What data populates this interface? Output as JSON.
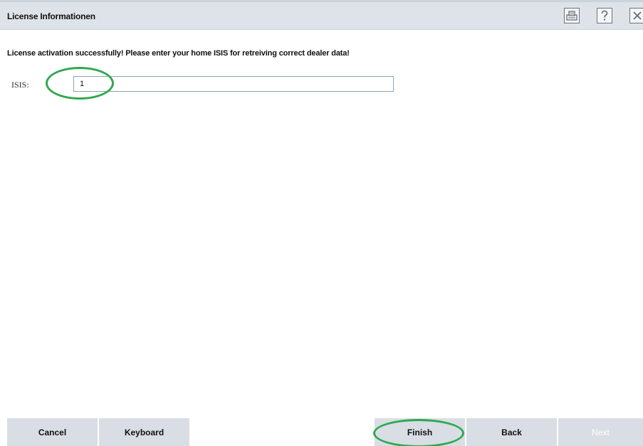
{
  "window": {
    "title": "License Informationen",
    "toolbar_icons": [
      "print-icon",
      "help-icon",
      "close-icon"
    ]
  },
  "main": {
    "message": "License activation successfully! Please enter your home ISIS for retreiving correct dealer data!",
    "isis": {
      "label": "ISIS:",
      "value": "1"
    }
  },
  "footer": {
    "cancel_label": "Cancel",
    "keyboard_label": "Keyboard",
    "finish_label": "Finish",
    "back_label": "Back",
    "next_label": "Next"
  },
  "colors": {
    "titlebar_bg": "#dde3e8",
    "button_bg": "#d8dee4",
    "highlight_ring": "#2fa84f",
    "disabled_text": "#ffffff"
  }
}
